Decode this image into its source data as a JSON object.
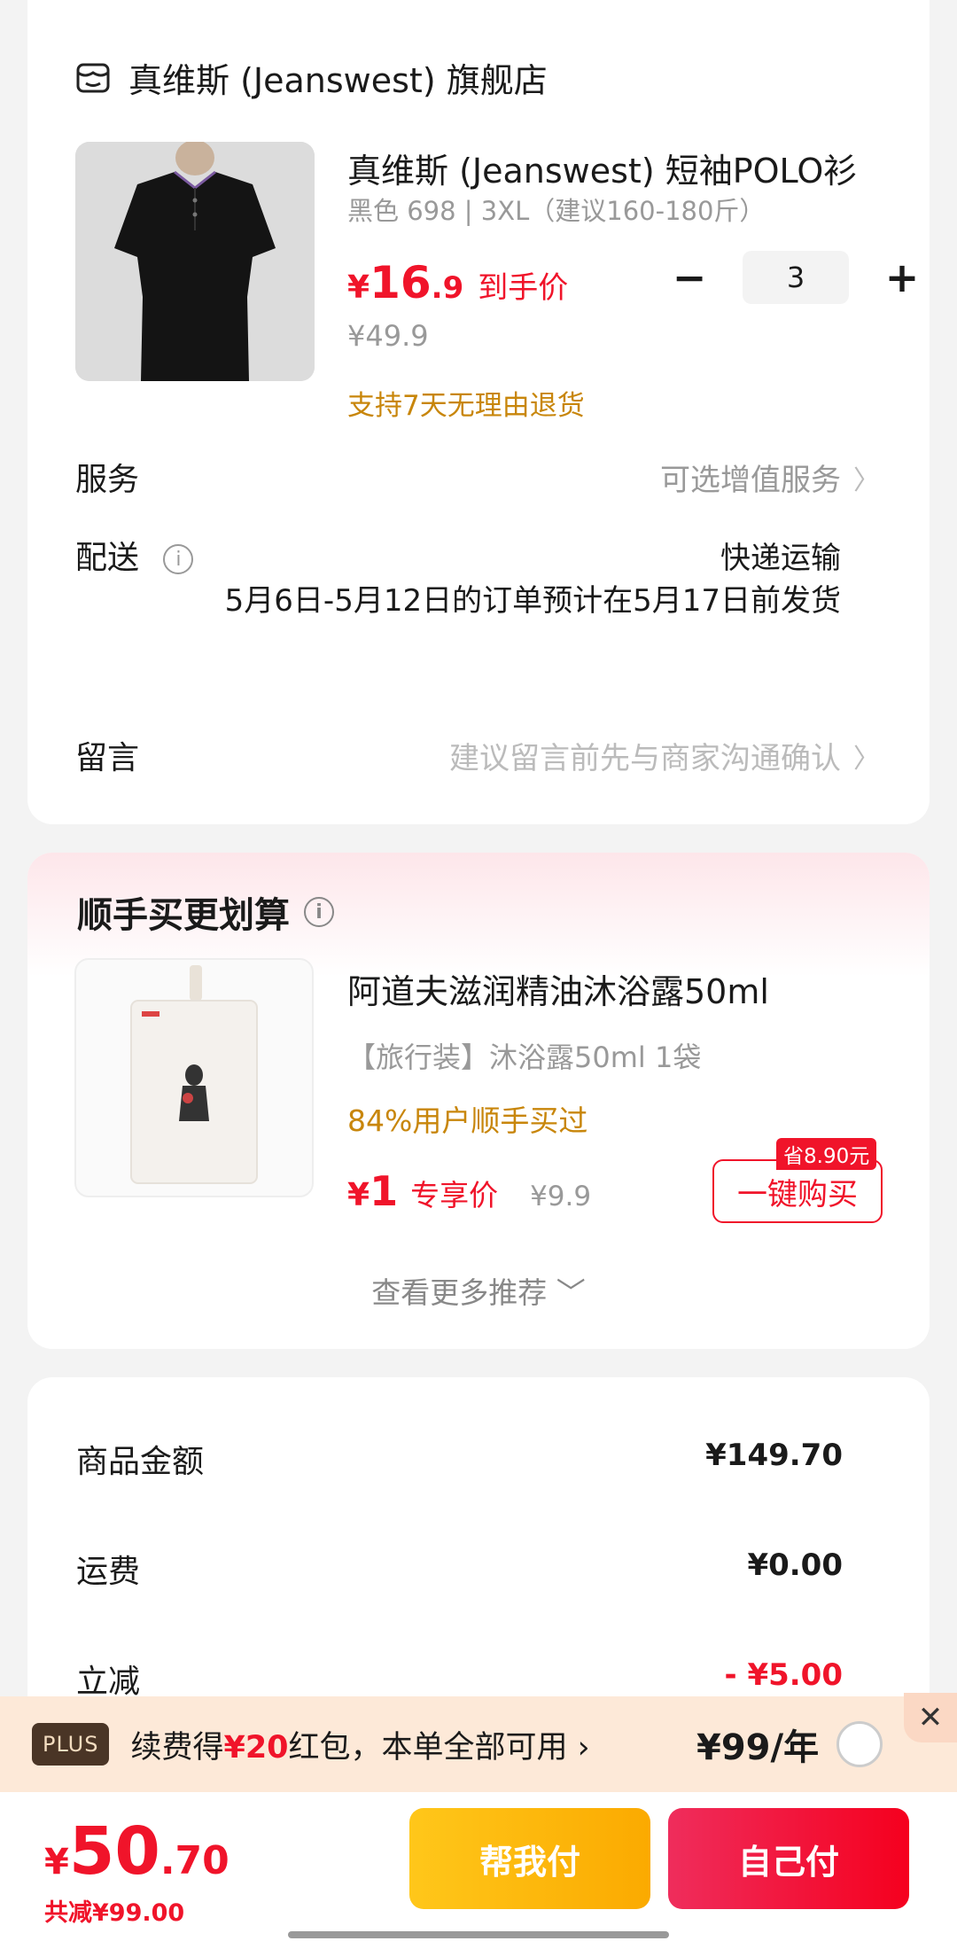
{
  "store": {
    "name": "真维斯 (Jeanswest) 旗舰店"
  },
  "product": {
    "title": "真维斯 (Jeanswest) 短袖POLO衫",
    "spec": "黑色 698 | 3XL（建议160-180斤）",
    "price_currency": "¥",
    "price_int": "16",
    "price_dec": ".9",
    "price_tag": "到手价",
    "orig_price": "¥49.9",
    "return_policy": "支持7天无理由退货",
    "qty": "3",
    "qty_minus": "−",
    "qty_plus": "+"
  },
  "rows": {
    "service_label": "服务",
    "service_value": "可选增值服务",
    "delivery_label": "配送",
    "delivery_type": "快递运输",
    "delivery_note": "5月6日-5月12日的订单预计在5月17日前发货",
    "message_label": "留言",
    "message_placeholder": "建议留言前先与商家沟通确认",
    "chevron": "〉",
    "info": "i"
  },
  "recommend": {
    "section_title": "顺手买更划算",
    "title": "阿道夫滋润精油沐浴露50ml",
    "spec": "【旅行装】沐浴露50ml 1袋",
    "social": "84%用户顺手买过",
    "price_currency": "¥",
    "price_int": "1",
    "price_tag": "专享价",
    "orig_price": "¥9.9",
    "save_badge": "省8.90元",
    "buy_label": "一键购买",
    "more": "查看更多推荐 ﹀"
  },
  "summary": {
    "goods_label": "商品金额",
    "goods_value": "¥149.70",
    "freight_label": "运费",
    "freight_value": "¥0.00",
    "discount_label": "立减",
    "discount_value": "- ¥5.00"
  },
  "plus": {
    "badge": "PLUS",
    "text_pre": "续费得",
    "text_hl": "¥20",
    "text_post": "红包，本单全部可用 ›",
    "price": "¥99/年",
    "close": "✕"
  },
  "checkout": {
    "currency": "¥",
    "total_int": "50",
    "total_dec": ".70",
    "saved": "共减¥99.00",
    "help_pay": "帮我付",
    "self_pay": "自己付"
  },
  "colors": {
    "accent": "#f0142a",
    "gold": "#c8860b",
    "plus_bg": "#fde9d8"
  }
}
